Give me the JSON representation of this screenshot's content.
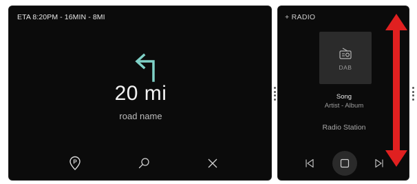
{
  "navigation": {
    "eta_text": "ETA 8:20PM - 16MIN - 8MI",
    "maneuver": "turn-left",
    "distance": "20 mi",
    "road_name": "road name",
    "buttons": [
      {
        "name": "parking",
        "icon": "parking-pin-icon"
      },
      {
        "name": "search",
        "icon": "search-icon"
      },
      {
        "name": "close",
        "icon": "close-icon"
      }
    ],
    "accent_color": "#7fd1c7"
  },
  "radio": {
    "title": "+ RADIO",
    "art_label": "DAB",
    "song": "Song",
    "artist_album": "Artist - Album",
    "station": "Radio Station",
    "controls": [
      "skip-previous-icon",
      "stop-icon",
      "skip-next-icon"
    ]
  },
  "overlay": {
    "arrow_color": "#e02020",
    "arrow_icon": "vertical-double-arrow-icon"
  }
}
